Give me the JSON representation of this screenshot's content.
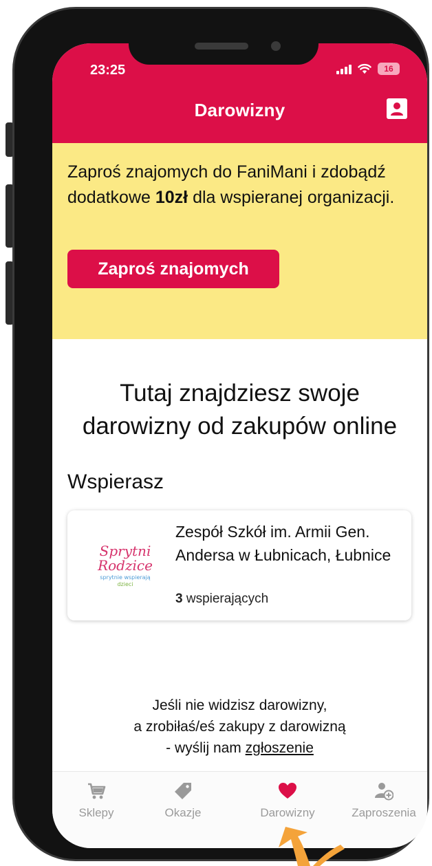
{
  "status_bar": {
    "time": "23:25",
    "battery": "16"
  },
  "header": {
    "title": "Darowizny"
  },
  "invite_banner": {
    "text_prefix": "Zaproś znajomych do FaniMani i zdobądź dodatkowe ",
    "text_bold": "10zł",
    "text_suffix": " dla wspieranej organizacji.",
    "button_label": "Zaproś znajomych"
  },
  "main": {
    "heading": "Tutaj znajdziesz swoje darowizny od zakupów online",
    "support_label": "Wspierasz",
    "organization": {
      "logo_text_1": "Sprytni",
      "logo_text_2": "Rodzice",
      "logo_text_3": "sprytnie wspierają",
      "logo_text_4": "dzieci",
      "name": "Zespół Szkół im. Armii Gen. Andersa w Łubnicach, Łubnice",
      "supporters_count": "3",
      "supporters_label": " wspierających"
    },
    "report": {
      "line1": "Jeśli nie widzisz darowizny,",
      "line2": "a zrobiłaś/eś zakupy z darowizną",
      "line3_prefix": "- wyślij nam ",
      "link": "zgłoszenie"
    }
  },
  "tabs": [
    {
      "label": "Sklepy",
      "icon": "cart-icon",
      "active": false
    },
    {
      "label": "Okazje",
      "icon": "tag-icon",
      "active": false
    },
    {
      "label": "Darowizny",
      "icon": "heart-icon",
      "active": true
    },
    {
      "label": "Zaproszenia",
      "icon": "add-person-icon",
      "active": false
    }
  ],
  "colors": {
    "brand": "#dc0f48",
    "banner": "#fbe985",
    "tab_inactive": "#9a9a9a",
    "arrow": "#f4a33a"
  }
}
